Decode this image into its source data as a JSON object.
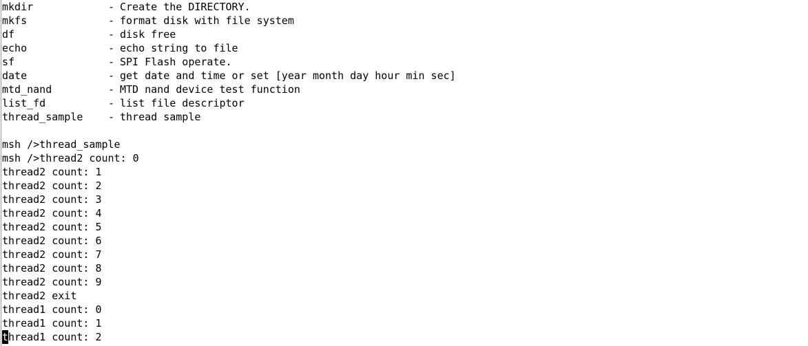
{
  "help_entries": [
    {
      "cmd": "mkdir",
      "desc": "Create the DIRECTORY."
    },
    {
      "cmd": "mkfs",
      "desc": "format disk with file system"
    },
    {
      "cmd": "df",
      "desc": "disk free"
    },
    {
      "cmd": "echo",
      "desc": "echo string to file"
    },
    {
      "cmd": "sf",
      "desc": "SPI Flash operate."
    },
    {
      "cmd": "date",
      "desc": "get date and time or set [year month day hour min sec]"
    },
    {
      "cmd": "mtd_nand",
      "desc": "MTD nand device test function"
    },
    {
      "cmd": "list_fd",
      "desc": "list file descriptor"
    },
    {
      "cmd": "thread_sample",
      "desc": "thread sample"
    }
  ],
  "separator": "-",
  "output_lines": [
    "msh />thread_sample",
    "msh />thread2 count: 0",
    "thread2 count: 1",
    "thread2 count: 2",
    "thread2 count: 3",
    "thread2 count: 4",
    "thread2 count: 5",
    "thread2 count: 6",
    "thread2 count: 7",
    "thread2 count: 8",
    "thread2 count: 9",
    "thread2 exit",
    "thread1 count: 0",
    "thread1 count: 1"
  ],
  "last_line": {
    "cursor_char": "t",
    "rest": "hread1 count: 2"
  }
}
